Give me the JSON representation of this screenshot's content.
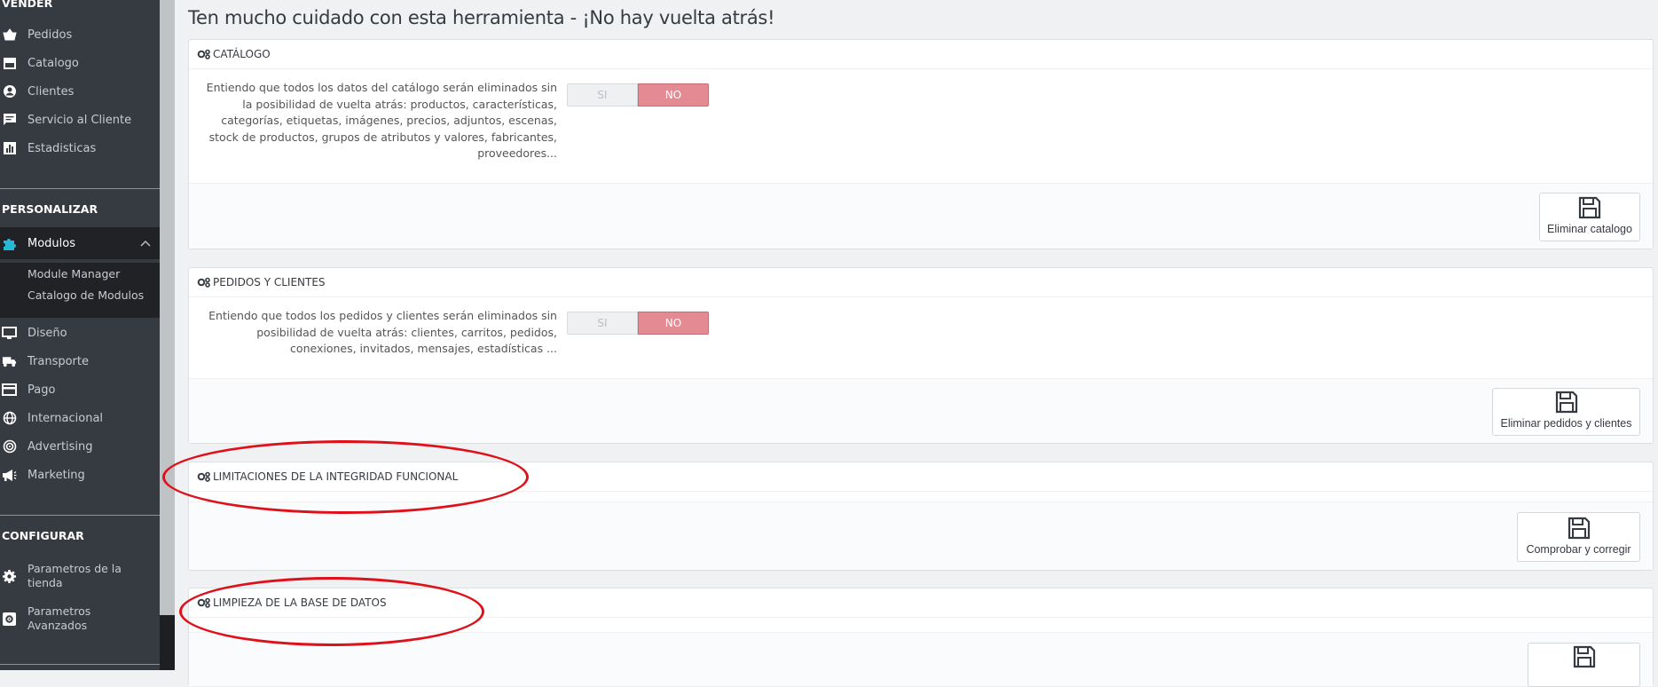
{
  "sidebar": {
    "section_sell": "VENDER",
    "sell_items": [
      {
        "label": "Pedidos",
        "icon": "basket-icon"
      },
      {
        "label": "Catalogo",
        "icon": "store-icon"
      },
      {
        "label": "Clientes",
        "icon": "user-circle-icon"
      },
      {
        "label": "Servicio al Cliente",
        "icon": "chat-icon"
      },
      {
        "label": "Estadisticas",
        "icon": "bar-chart-icon"
      }
    ],
    "section_customize": "PERSONALIZAR",
    "modules_label": "Modulos",
    "modules_sub": [
      "Module Manager",
      "Catalogo de Modulos"
    ],
    "customize_items": [
      {
        "label": "Diseño",
        "icon": "monitor-icon"
      },
      {
        "label": "Transporte",
        "icon": "truck-icon"
      },
      {
        "label": "Pago",
        "icon": "card-icon"
      },
      {
        "label": "Internacional",
        "icon": "globe-icon"
      },
      {
        "label": "Advertising",
        "icon": "target-icon"
      },
      {
        "label": "Marketing",
        "icon": "megaphone-icon"
      }
    ],
    "section_configure": "CONFIGURAR",
    "configure_items": [
      {
        "label": "Parametros de la tienda",
        "icon": "gear-icon"
      },
      {
        "label": "Parametros Avanzados",
        "icon": "gear-box-icon"
      }
    ]
  },
  "page": {
    "title": "Ten mucho cuidado con esta herramienta - ¡No hay vuelta atrás!"
  },
  "panels": {
    "catalog": {
      "heading": "CATÁLOGO",
      "description": "Entiendo que todos los datos del catálogo serán eliminados sin la posibilidad de vuelta atrás: productos, características, categorías, etiquetas, imágenes, precios, adjuntos, escenas, stock de productos, grupos de atributos y valores, fabricantes, proveedores...",
      "switch_yes": "SI",
      "switch_no": "NO",
      "button": "Eliminar catalogo"
    },
    "orders": {
      "heading": "PEDIDOS Y CLIENTES",
      "description": "Entiendo que todos los pedidos y clientes serán eliminados sin posibilidad de vuelta atrás: clientes, carritos, pedidos, conexiones, invitados, mensajes, estadísticas ...",
      "switch_yes": "SI",
      "switch_no": "NO",
      "button": "Eliminar pedidos y clientes"
    },
    "integrity": {
      "heading": "LIMITACIONES DE LA INTEGRIDAD FUNCIONAL",
      "button": "Comprobar y corregir"
    },
    "cleanup": {
      "heading": "LIMPIEZA DE LA BASE DE DATOS"
    }
  },
  "colors": {
    "sidebar_bg": "#363a41",
    "switch_no_bg": "#e48a92",
    "annotation_red": "#e0101a"
  }
}
